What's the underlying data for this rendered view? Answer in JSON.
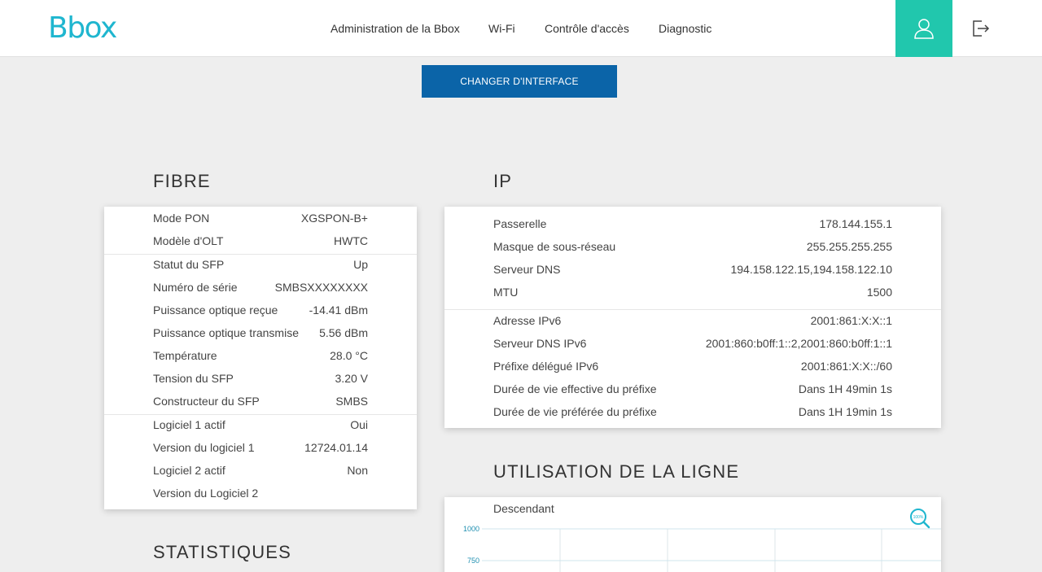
{
  "header": {
    "logo": "Bbox",
    "nav": [
      "Administration de la Bbox",
      "Wi-Fi",
      "Contrôle d'accès",
      "Diagnostic"
    ]
  },
  "change_interface_label": "CHANGER D'INTERFACE",
  "fibre": {
    "title": "FIBRE",
    "groups": [
      [
        {
          "label": "Mode PON",
          "value": "XGSPON-B+"
        },
        {
          "label": "Modèle d'OLT",
          "value": "HWTC"
        }
      ],
      [
        {
          "label": "Statut du SFP",
          "value": "Up"
        },
        {
          "label": "Numéro de série",
          "value": "SMBSXXXXXXXX"
        },
        {
          "label": "Puissance optique reçue",
          "value": "-14.41 dBm"
        },
        {
          "label": "Puissance optique transmise",
          "value": "5.56 dBm"
        },
        {
          "label": "Température",
          "value": "28.0 °C"
        },
        {
          "label": "Tension du SFP",
          "value": "3.20 V"
        },
        {
          "label": "Constructeur du SFP",
          "value": "SMBS"
        }
      ],
      [
        {
          "label": "Logiciel 1 actif",
          "value": "Oui"
        },
        {
          "label": "Version du logiciel 1",
          "value": "12724.01.14"
        },
        {
          "label": "Logiciel 2 actif",
          "value": "Non"
        },
        {
          "label": "Version du Logiciel 2",
          "value": ""
        }
      ]
    ]
  },
  "ip": {
    "title": "IP",
    "groups": [
      [
        {
          "label": "Passerelle",
          "value": "178.144.155.1"
        },
        {
          "label": "Masque de sous-réseau",
          "value": "255.255.255.255"
        },
        {
          "label": "Serveur DNS",
          "value": "194.158.122.15,194.158.122.10"
        },
        {
          "label": "MTU",
          "value": "1500"
        }
      ],
      [
        {
          "label": "Adresse IPv6",
          "value": "2001:861:X:X::1"
        },
        {
          "label": "Serveur DNS IPv6",
          "value": "2001:860:b0ff:1::2,2001:860:b0ff:1::1"
        },
        {
          "label": "Préfixe délégué IPv6",
          "value": "2001:861:X:X::/60"
        },
        {
          "label": "Durée de vie effective du préfixe",
          "value": "Dans 1H 49min 1s"
        },
        {
          "label": "Durée de vie préférée du préfixe",
          "value": "Dans 1H 19min 1s"
        }
      ]
    ]
  },
  "ligne": {
    "title": "UTILISATION DE LA LIGNE",
    "chart_title": "Descendant",
    "zoom_icon_label": "100%"
  },
  "statistiques": {
    "title": "STATISTIQUES"
  },
  "chart_data": {
    "type": "line",
    "title": "Descendant",
    "yticks": [
      "1000",
      "750"
    ],
    "ylim": [
      0,
      1000
    ],
    "grid": true,
    "series": []
  },
  "colors": {
    "brand": "#1fb6cf",
    "accent": "#21c7ad",
    "button": "#0b64a8",
    "background": "#eeeeee"
  }
}
